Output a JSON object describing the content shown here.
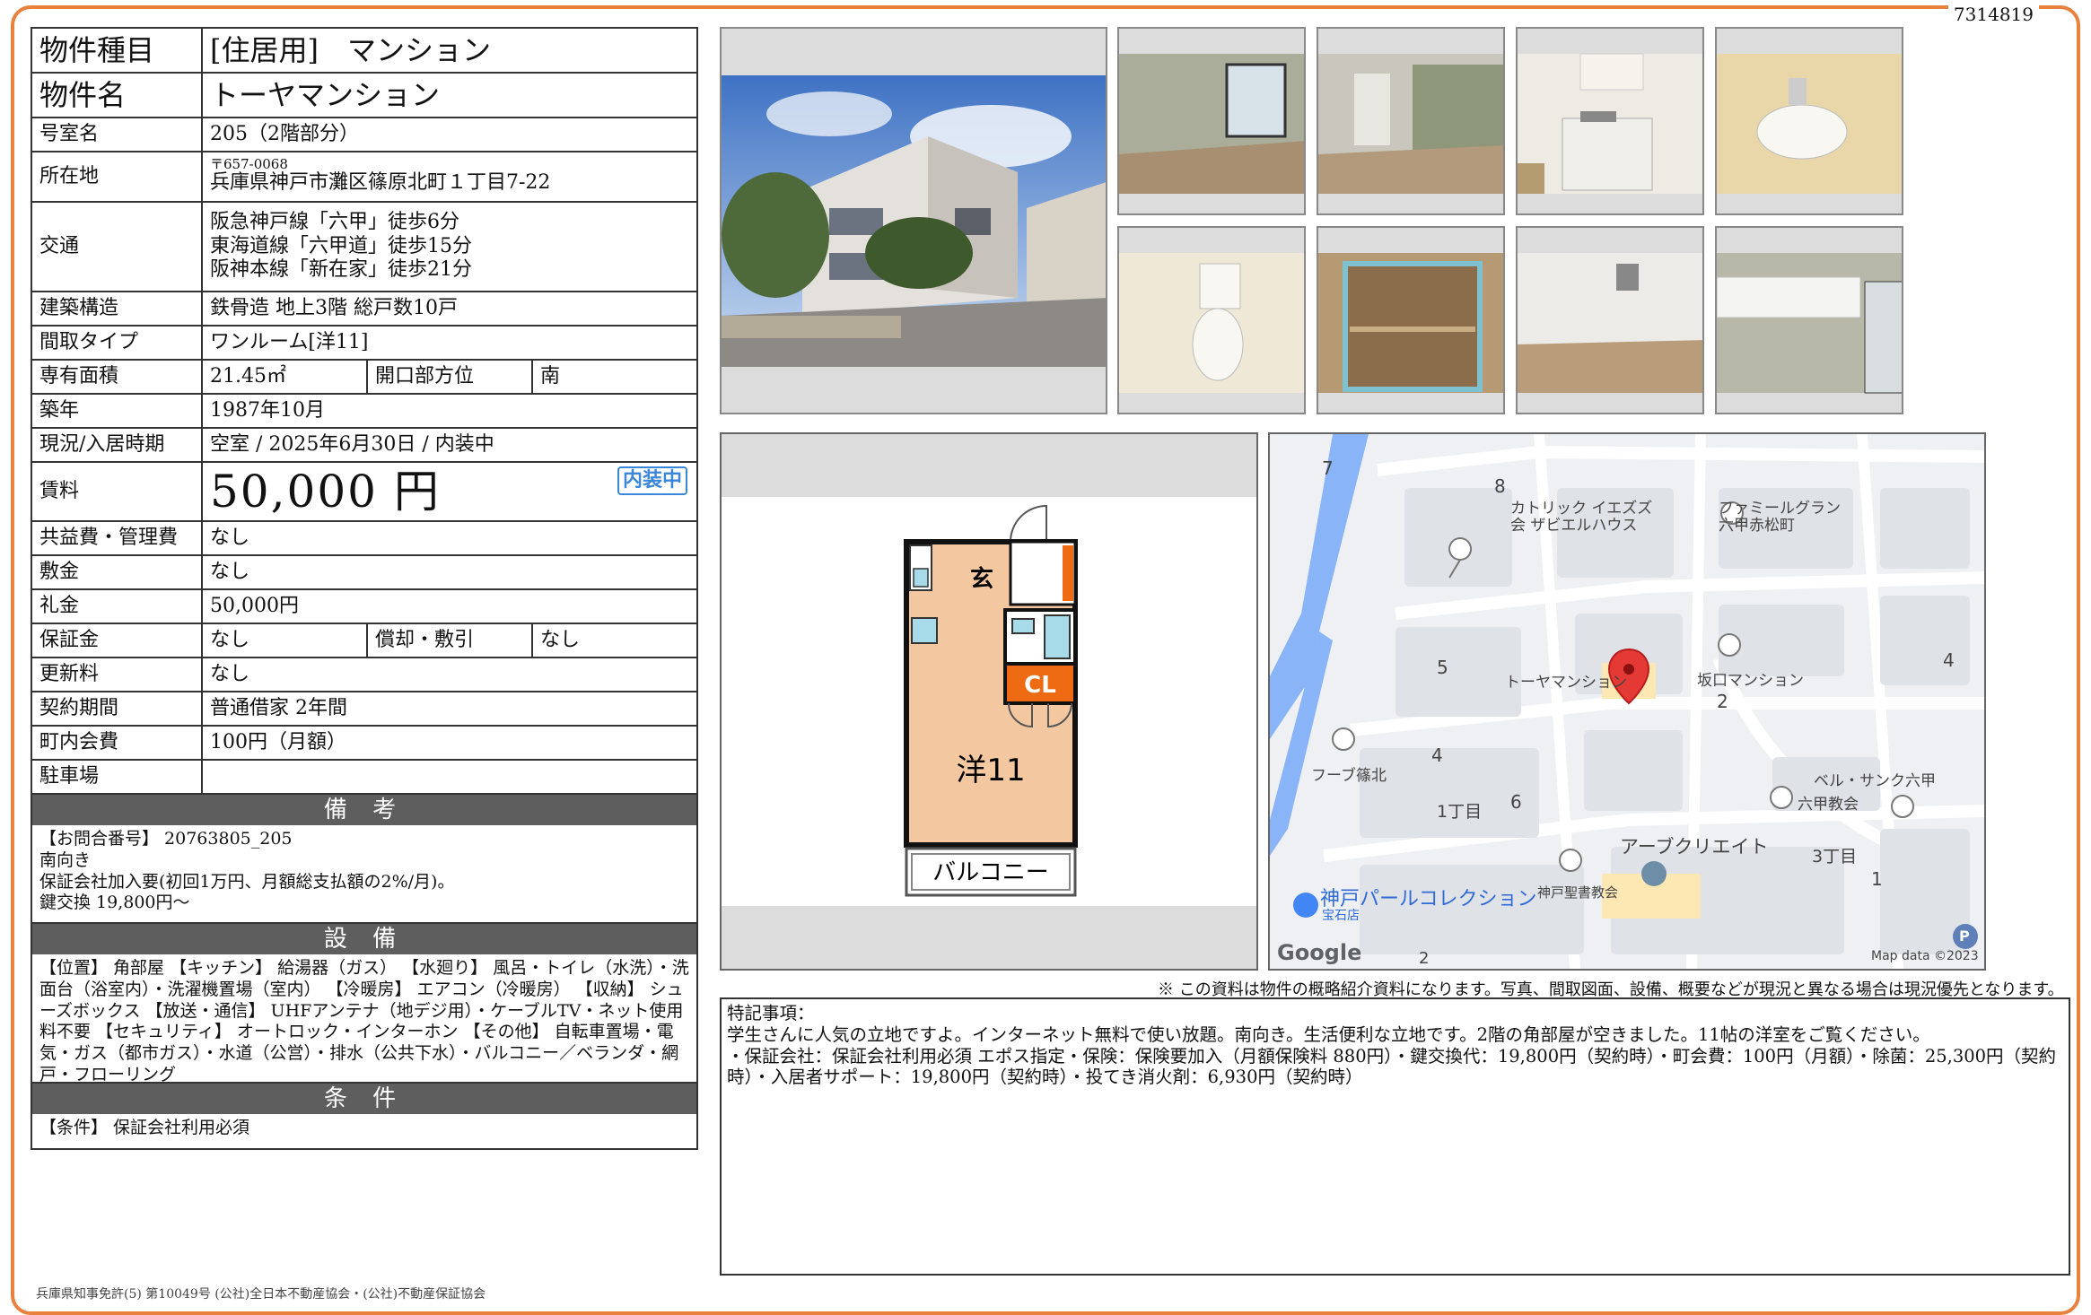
{
  "doc_id": "7314819",
  "property": {
    "type_label": "物件種目",
    "type_value": "[住居用]　マンション",
    "name_label": "物件名",
    "name_value": "トーヤマンション",
    "room_label": "号室名",
    "room_value": "205（2階部分）",
    "address_label": "所在地",
    "postal": "〒657-0068",
    "address": "兵庫県神戸市灘区篠原北町１丁目7-22",
    "access_label": "交通",
    "access": [
      "阪急神戸線「六甲」徒歩6分",
      "東海道線「六甲道」徒歩15分",
      "阪神本線「新在家」徒歩21分"
    ],
    "structure_label": "建築構造",
    "structure_value": "鉄骨造 地上3階 総戸数10戸",
    "layout_label": "間取タイプ",
    "layout_value": "ワンルーム[洋11]",
    "area_label": "専有面積",
    "area_value": "21.45㎡",
    "direction_label": "開口部方位",
    "direction_value": "南",
    "built_label": "築年",
    "built_value": "1987年10月",
    "status_label": "現況/入居時期",
    "status_value": "空室 / 2025年6月30日 / 内装中",
    "rent_label": "賃料",
    "rent_value": "50,000 円",
    "rent_badge": "内装中",
    "common_label": "共益費・管理費",
    "common_value": "なし",
    "deposit_label": "敷金",
    "deposit_value": "なし",
    "keymoney_label": "礼金",
    "keymoney_value": "50,000円",
    "guarantee_label": "保証金",
    "guarantee_value": "なし",
    "amort_label": "償却・敷引",
    "amort_value": "なし",
    "renewal_label": "更新料",
    "renewal_value": "なし",
    "contract_label": "契約期間",
    "contract_value": "普通借家 2年間",
    "town_label": "町内会費",
    "town_value": "100円（月額）",
    "parking_label": "駐車場",
    "parking_value": ""
  },
  "biko": {
    "heading": "備 考",
    "lines": [
      "【お問合番号】 20763805_205",
      "南向き",
      "保証会社加入要(初回1万円、月額総支払額の2%/月)。",
      "鍵交換 19,800円〜"
    ]
  },
  "setsubi": {
    "heading": "設 備",
    "text": "【位置】 角部屋 【キッチン】 給湯器（ガス） 【水廻り】 風呂・トイレ（水洗）・洗面台（浴室内）・洗濯機置場（室内） 【冷暖房】 エアコン（冷暖房） 【収納】 シューズボックス 【放送・通信】 UHFアンテナ（地デジ用）・ケーブルTV・ネット使用料不要 【セキュリティ】 オートロック・インターホン 【その他】 自転車置場・電気・ガス（都市ガス）・水道（公営）・排水（公共下水）・バルコニー／ベランダ・網戸・フローリング"
  },
  "joken": {
    "heading": "条 件",
    "text": "【条件】 保証会社利用必須"
  },
  "floorplan": {
    "entrance": "玄",
    "closet": "CL",
    "room": "洋11",
    "balcony": "バルコニー"
  },
  "map": {
    "labels": {
      "l7": "7",
      "l8": "8",
      "catholic": "カトリック イエズズ\n会 ザビエルハウス",
      "famille": "ファミールグラン\n六甲赤松町",
      "l5": "5",
      "toya": "トーヤマンション",
      "sakaguchi": "坂口マンション",
      "l2": "2",
      "l4r": "4",
      "hoop": "フーブ篠北",
      "l4": "4",
      "chome1": "1丁目",
      "l6": "6",
      "bell": "ベル・サンク六甲",
      "rokko_church": "六甲教会",
      "apcreate": "アーブクリエイト",
      "chome3": "3丁目",
      "l1": "1",
      "pearl": "神戸パールコレクション",
      "pearl_sub": "宝石店",
      "bible": "神戸聖書教会",
      "google": "Google",
      "mapdata": "Map data ©2023",
      "l2b": "2",
      "parking": "P"
    }
  },
  "notice": "※ この資料は物件の概略紹介資料になります。写真、間取図面、設備、概要などが現況と異なる場合は現況優先となります。",
  "remarks": {
    "heading": "特記事項：",
    "line1": "学生さんに人気の立地ですよ。インターネット無料で使い放題。南向き。生活便利な立地です。2階の角部屋が空きました。11帖の洋室をご覧ください。",
    "line2": "・保証会社：保証会社利用必須 エポス指定・保険：保険要加入（月額保険料 880円）・鍵交換代：19,800円（契約時）・町会費：100円（月額）・除菌：25,300円（契約時）・入居者サポート：19,800円（契約時）・投てき消火剤：6,930円（契約時）"
  },
  "footer": "兵庫県知事免許(5) 第10049号 (公社)全日本不動産協会・(公社)不動産保証協会"
}
